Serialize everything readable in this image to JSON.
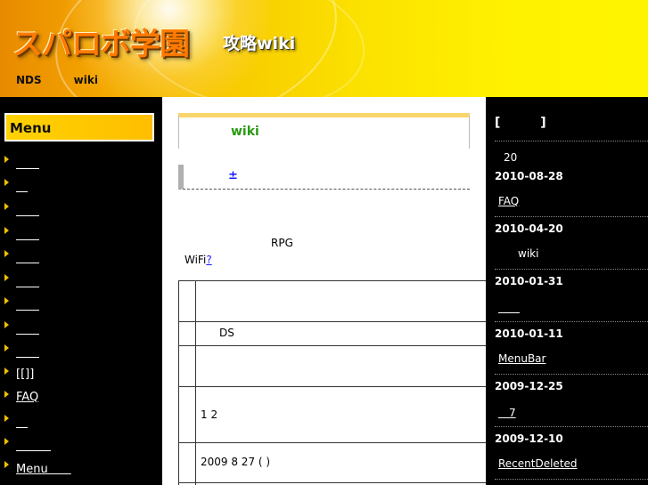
{
  "header": {
    "logo": "スパロボ学園",
    "subtitle": "攻略wiki",
    "nav": [
      "NDS",
      "wiki"
    ]
  },
  "menu": {
    "title": "Menu",
    "items": [
      {
        "label": "　　"
      },
      {
        "label": "　"
      },
      {
        "label": "　　"
      },
      {
        "label": "　　"
      },
      {
        "label": "　　"
      },
      {
        "label": "　　"
      },
      {
        "label": "　　"
      },
      {
        "label": "　　"
      },
      {
        "label": "　　"
      },
      {
        "label": "[[]]"
      },
      {
        "label": "FAQ"
      },
      {
        "label": "　"
      },
      {
        "label": "　　　"
      },
      {
        "label": "Menu　　"
      }
    ]
  },
  "main": {
    "title": "wiki",
    "sub_heading": "±",
    "para_rpg": "RPG",
    "para_wifi": "WiFi",
    "wifi_link": "?",
    "table": {
      "rows": [
        "",
        "DS",
        "",
        "1 2",
        "2009 8 27 ( )"
      ]
    }
  },
  "sidebar": {
    "title": "[ ]",
    "count": "20",
    "entries": [
      {
        "date": "2010-08-28",
        "link": "FAQ"
      },
      {
        "date": "2010-04-20",
        "text": "wiki"
      },
      {
        "date": "2010-01-31",
        "link": "　　"
      },
      {
        "date": "2010-01-11",
        "link": "MenuBar"
      },
      {
        "date": "2009-12-25",
        "link": "　7"
      },
      {
        "date": "2009-12-10",
        "link": "RecentDeleted"
      }
    ]
  }
}
